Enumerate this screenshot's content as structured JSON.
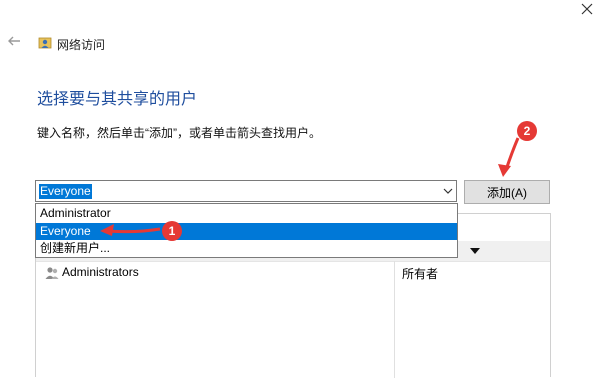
{
  "window": {
    "title": "网络访问",
    "back_icon": "back-arrow-icon",
    "close_icon": "close-icon"
  },
  "page": {
    "heading": "选择要与其共享的用户",
    "instruction": "键入名称，然后单击“添加”，或者单击箭头查找用户。"
  },
  "combo": {
    "value": "Everyone",
    "options": [
      "Administrator",
      "Everyone",
      "创建新用户..."
    ],
    "selected_index": 1
  },
  "add_button": {
    "label": "添加(A)"
  },
  "table": {
    "rows": [
      {
        "name": "Administrators",
        "permission": "所有者"
      }
    ]
  },
  "annotations": {
    "badge1": "1",
    "badge2": "2",
    "color": "#e53935"
  },
  "colors": {
    "accent": "#0078d7",
    "heading": "#1f4e9e"
  }
}
